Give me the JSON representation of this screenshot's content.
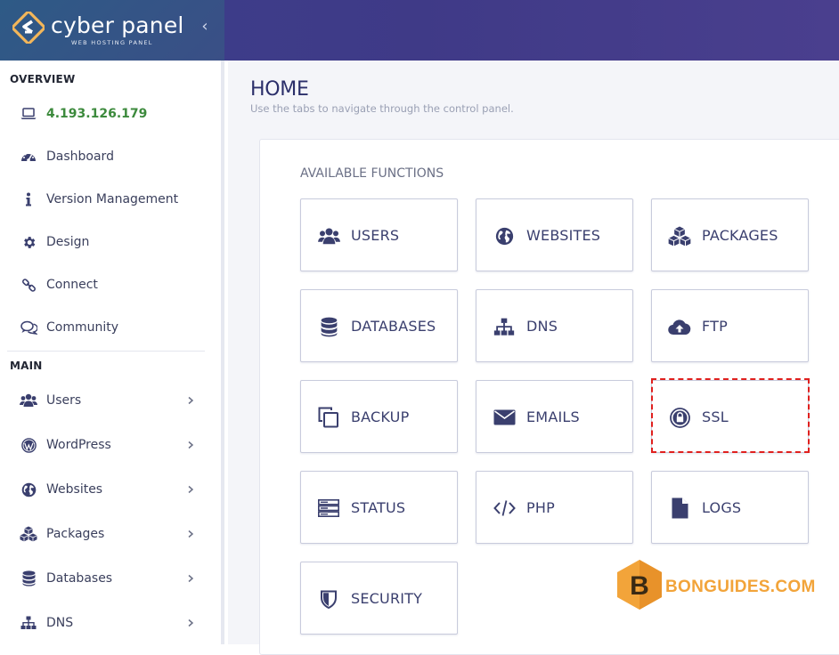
{
  "brand": {
    "name": "cyber panel",
    "tagline": "WEB HOSTING PANEL",
    "collapse_icon": "chevron-left-icon"
  },
  "sidebar": {
    "overview_heading": "OVERVIEW",
    "main_heading": "MAIN",
    "overview_items": [
      {
        "label": "4.193.126.179",
        "icon": "laptop-icon"
      },
      {
        "label": "Dashboard",
        "icon": "tachometer-icon"
      },
      {
        "label": "Version Management",
        "icon": "info-icon"
      },
      {
        "label": "Design",
        "icon": "cog-icon"
      },
      {
        "label": "Connect",
        "icon": "link-icon"
      },
      {
        "label": "Community",
        "icon": "comments-icon"
      }
    ],
    "main_items": [
      {
        "label": "Users",
        "icon": "users-icon"
      },
      {
        "label": "WordPress",
        "icon": "wordpress-icon"
      },
      {
        "label": "Websites",
        "icon": "globe-icon"
      },
      {
        "label": "Packages",
        "icon": "cubes-icon"
      },
      {
        "label": "Databases",
        "icon": "database-icon"
      },
      {
        "label": "DNS",
        "icon": "sitemap-icon"
      }
    ]
  },
  "page": {
    "title": "HOME",
    "subtitle": "Use the tabs to navigate through the control panel.",
    "section_title": "AVAILABLE FUNCTIONS"
  },
  "functions": [
    {
      "label": "USERS",
      "icon": "users-icon"
    },
    {
      "label": "WEBSITES",
      "icon": "globe-icon"
    },
    {
      "label": "PACKAGES",
      "icon": "cubes-icon"
    },
    {
      "label": "DATABASES",
      "icon": "database-icon"
    },
    {
      "label": "DNS",
      "icon": "sitemap-icon"
    },
    {
      "label": "FTP",
      "icon": "cloud-upload-icon"
    },
    {
      "label": "BACKUP",
      "icon": "copy-icon"
    },
    {
      "label": "EMAILS",
      "icon": "envelope-icon"
    },
    {
      "label": "SSL",
      "icon": "lock-icon"
    },
    {
      "label": "STATUS",
      "icon": "server-icon"
    },
    {
      "label": "PHP",
      "icon": "code-icon"
    },
    {
      "label": "LOGS",
      "icon": "file-icon"
    },
    {
      "label": "SECURITY",
      "icon": "shield-icon"
    }
  ],
  "watermark": {
    "letter": "B",
    "text": "BONGUIDES.COM"
  },
  "colors": {
    "accent": "#3b3f8c",
    "icon": "#3a3f6e",
    "ip_text": "#3c8a3c",
    "highlight": "#e0201e",
    "watermark": "#f2a43a"
  }
}
